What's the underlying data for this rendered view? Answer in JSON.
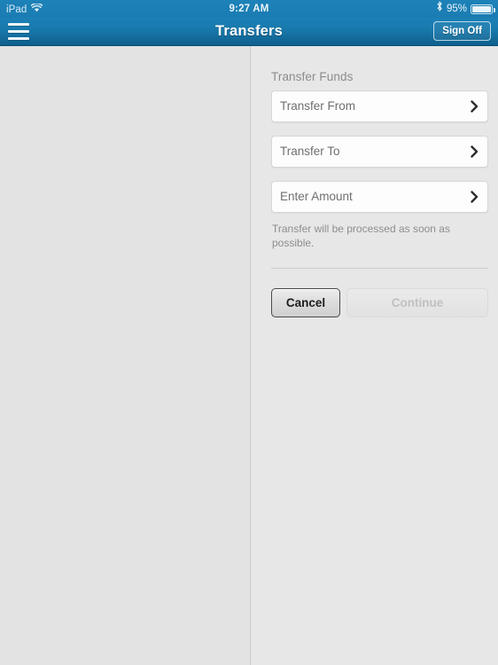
{
  "statusbar": {
    "device": "iPad",
    "wifi_icon": "wifi-icon",
    "time": "9:27 AM",
    "bluetooth_icon": "bluetooth-icon",
    "battery_percent": "95%",
    "battery_icon": "battery-icon"
  },
  "navbar": {
    "menu_icon": "hamburger-menu-icon",
    "title": "Transfers",
    "signoff_label": "Sign Off",
    "background_color": "#1878ab"
  },
  "main": {
    "section_title": "Transfer Funds",
    "fields": [
      {
        "label": "Transfer From",
        "chevron": "chevron-right-icon"
      },
      {
        "label": "Transfer To",
        "chevron": "chevron-right-icon"
      },
      {
        "label": "Enter Amount",
        "chevron": "chevron-right-icon"
      }
    ],
    "helper_text": "Transfer will be processed as soon as possible.",
    "buttons": {
      "cancel_label": "Cancel",
      "continue_label": "Continue"
    }
  }
}
